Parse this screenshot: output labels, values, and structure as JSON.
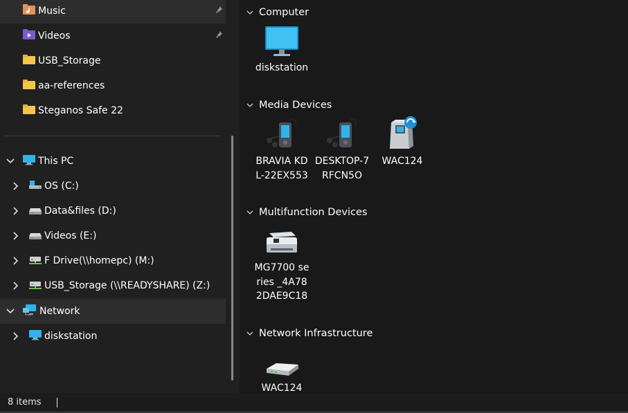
{
  "nav": {
    "quick_access": [
      {
        "label": "Music",
        "icon": "music-folder-icon",
        "pinned": true
      },
      {
        "label": "Videos",
        "icon": "videos-folder-icon",
        "pinned": true
      },
      {
        "label": "USB_Storage",
        "icon": "folder-icon",
        "pinned": false
      },
      {
        "label": "aa-references",
        "icon": "folder-icon",
        "pinned": false
      },
      {
        "label": "Steganos Safe 22",
        "icon": "folder-icon",
        "pinned": false
      }
    ],
    "this_pc": {
      "label": "This PC",
      "drives": [
        {
          "label": "OS (C:)",
          "icon": "os-drive-icon"
        },
        {
          "label": "Data&files (D:)",
          "icon": "drive-icon"
        },
        {
          "label": "Videos (E:)",
          "icon": "drive-icon"
        },
        {
          "label": "F Drive(\\\\homepc) (M:)",
          "icon": "network-drive-icon"
        },
        {
          "label": "USB_Storage (\\\\READYSHARE) (Z:)",
          "icon": "network-drive-icon"
        }
      ]
    },
    "network": {
      "label": "Network",
      "children": [
        {
          "label": "diskstation",
          "icon": "computer-icon"
        }
      ]
    }
  },
  "content": {
    "groups": [
      {
        "title": "Computer",
        "items": [
          {
            "label": "diskstation",
            "icon": "monitor-icon"
          }
        ]
      },
      {
        "title": "Media Devices",
        "items": [
          {
            "label": "BRAVIA KDL-22EX553",
            "icon": "media-player-icon"
          },
          {
            "label": "DESKTOP-7RFCN5O",
            "icon": "media-player-icon"
          },
          {
            "label": "WAC124",
            "icon": "media-server-icon"
          }
        ]
      },
      {
        "title": "Multifunction Devices",
        "items": [
          {
            "label": "MG7700 series _4A782DAE9C18",
            "icon": "printer-icon"
          }
        ]
      },
      {
        "title": "Network Infrastructure",
        "items": [
          {
            "label": "WAC124",
            "icon": "router-icon"
          }
        ]
      }
    ]
  },
  "status": {
    "item_count": "8 items"
  },
  "colors": {
    "folder": "#f3c54b",
    "monitor": "#2fb3ea",
    "selected": "#2d2d2d"
  }
}
